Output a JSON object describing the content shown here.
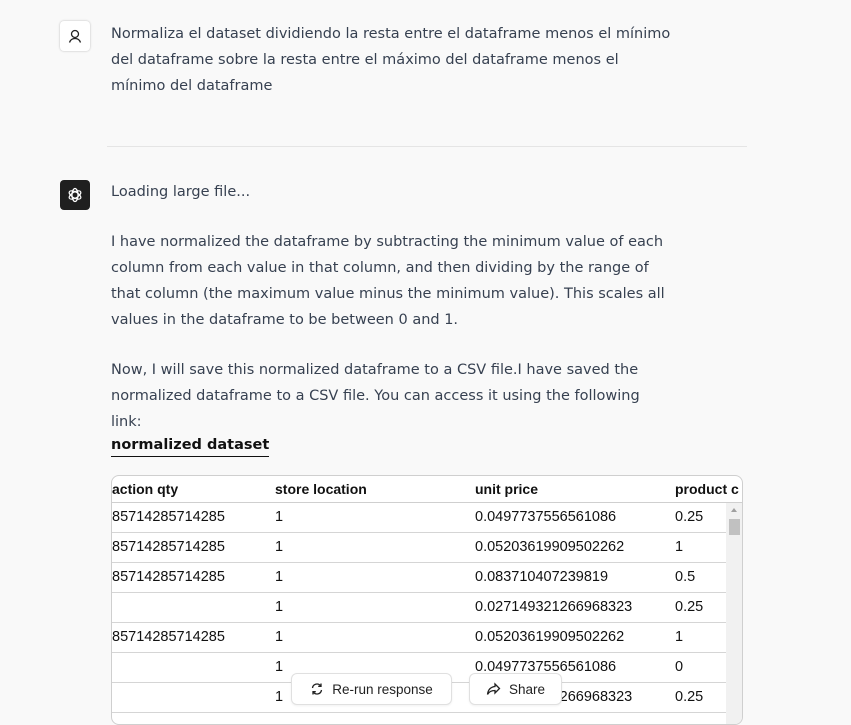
{
  "user_message": "Normaliza el dataset dividiendo la resta entre el dataframe menos el mínimo del dataframe sobre la resta entre el máximo del dataframe menos el mínimo del dataframe",
  "assistant": {
    "status": "Loading large file...",
    "paragraph1": "I have normalized the dataframe by subtracting the minimum value of each column from each value in that column, and then dividing by the range of that column (the maximum value minus the minimum value). This scales all values in the dataframe to be between 0 and 1.",
    "paragraph2": "Now, I will save this normalized dataframe to a CSV file.I have saved the normalized dataframe to a CSV file. You can access it using the following link:",
    "link_label": "normalized dataset"
  },
  "table": {
    "columns": [
      "action  qty",
      "store  location",
      "unit  price",
      "product  c"
    ],
    "rows": [
      [
        "85714285714285",
        "1",
        "0.0497737556561086",
        "0.25"
      ],
      [
        "85714285714285",
        "1",
        "0.05203619909502262",
        "1"
      ],
      [
        "85714285714285",
        "1",
        "0.083710407239819",
        "0.5"
      ],
      [
        "",
        "1",
        "0.027149321266968323",
        "0.25"
      ],
      [
        "85714285714285",
        "1",
        "0.05203619909502262",
        "1"
      ],
      [
        "",
        "1",
        "0.0497737556561086",
        "0"
      ],
      [
        "",
        "1",
        "0.027149321266968323",
        "0.25"
      ]
    ]
  },
  "buttons": {
    "rerun": "Re-run response",
    "share": "Share"
  },
  "icons": {
    "user": "user-icon",
    "assistant": "openai-logo-icon",
    "rerun": "refresh-icon",
    "share": "share-icon"
  }
}
